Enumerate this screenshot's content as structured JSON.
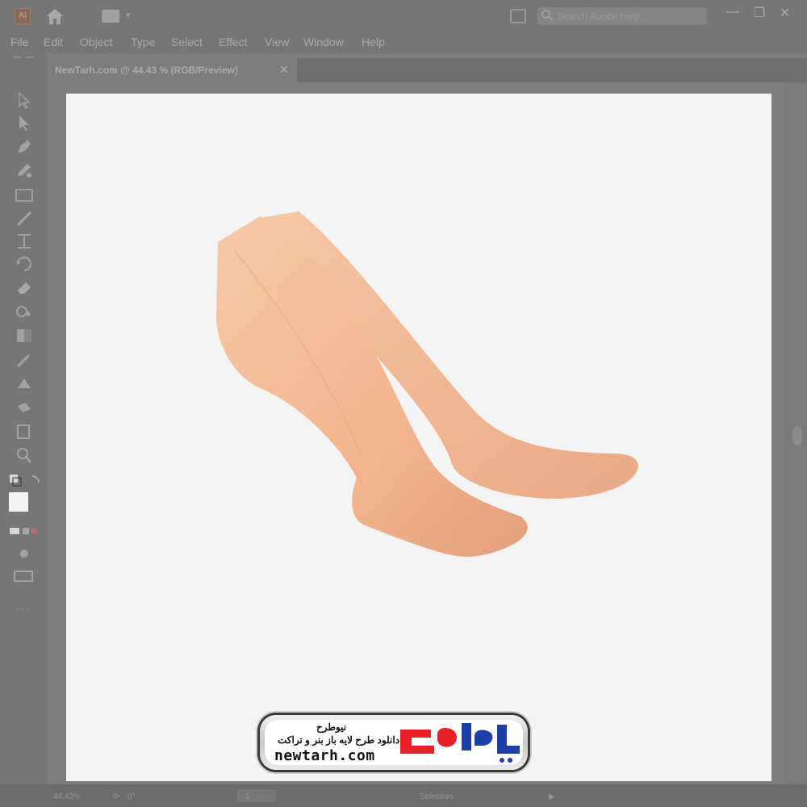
{
  "app": {
    "icon_text": "Ai"
  },
  "search": {
    "placeholder": "Search Adobe Help"
  },
  "menu": [
    "File",
    "Edit",
    "Object",
    "Type",
    "Select",
    "Effect",
    "View",
    "Window",
    "Help"
  ],
  "document": {
    "tab_title": "NewTarh.com @ 44.43 % (RGB/Preview)",
    "close": "✕"
  },
  "window_controls": {
    "minimize": "—",
    "restore": "❐",
    "close": "✕"
  },
  "tools": [
    "selection-tool",
    "direct-selection-tool",
    "pen-tool",
    "pencil-tool",
    "rectangle-tool",
    "brush-tool",
    "width-tool",
    "rotate-tool",
    "eraser-tool",
    "shape-builder-tool",
    "gradient-tool",
    "eyedropper-tool",
    "blend-tool",
    "symbol-sprayer-tool",
    "artboard-tool",
    "zoom-tool"
  ],
  "status": {
    "zoom": "44.43%",
    "rotation": "0°",
    "artboard": "1",
    "mode": "Selection"
  },
  "watermark": {
    "title_fa": "نیوطرح",
    "subtitle_fa": "دانلود طرح لایه باز بنر و تراکت",
    "url": "newtarh.com"
  },
  "colors": {
    "ui_bg": "#767676",
    "artboard": "#f4f4f4",
    "skin": "#f2b48e"
  }
}
